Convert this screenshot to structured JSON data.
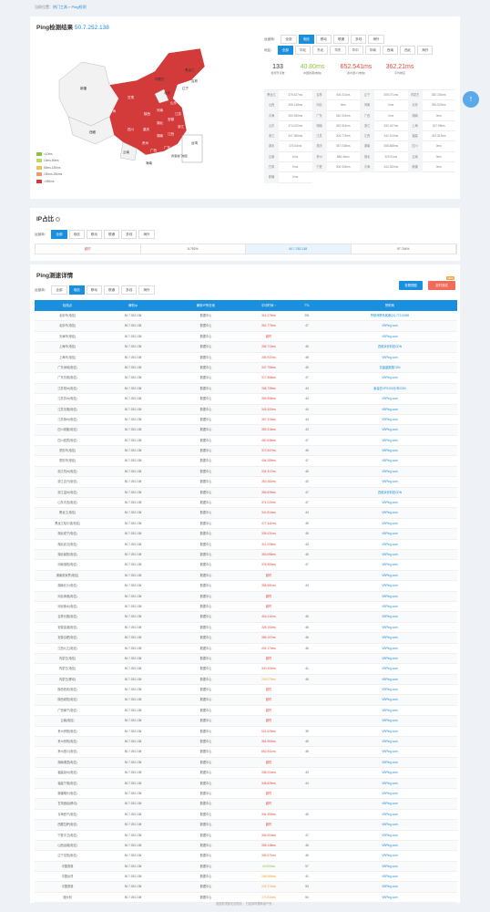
{
  "breadcrumb": {
    "prefix": "当前位置：",
    "link1": "热门工具",
    "sep": " » ",
    "link2": "Ping检测"
  },
  "result": {
    "title": "Ping检测结果",
    "ip": "50.7.252.138"
  },
  "operator": {
    "label": "运营商：",
    "options": [
      "全部",
      "电信",
      "移动",
      "联通",
      "多线",
      "海外"
    ],
    "active": 1
  },
  "region": {
    "label": "地区：",
    "options": [
      "全部",
      "华北",
      "东北",
      "华东",
      "华中",
      "华南",
      "西南",
      "西北",
      "海外"
    ],
    "active": 0
  },
  "stats": [
    {
      "v": "133",
      "l": "检测节点数",
      "c": "#333"
    },
    {
      "v": "40.80ms",
      "l": "中国香港(电信)",
      "c": "#8ac43f"
    },
    {
      "v": "652.541ms",
      "l": "贵州遵义(电信)",
      "c": "#e04a3b"
    },
    {
      "v": "362.21ms",
      "l": "平均响应",
      "c": "#e04a3b"
    }
  ],
  "regions": [
    [
      "黑龙江",
      "375.627ms"
    ],
    [
      "吉林",
      "404.411ms"
    ],
    [
      "辽宁",
      "305.071ms"
    ],
    [
      "内蒙古",
      "382.181ms"
    ],
    [
      "山西",
      "308.148ms"
    ],
    [
      "河北",
      "0ms"
    ],
    [
      "河南",
      "0ms"
    ],
    [
      "北京",
      "364.529ms"
    ],
    [
      "青海",
      "350.355ms"
    ],
    [
      "广东",
      "362.924ms"
    ],
    [
      "广西",
      "0ms"
    ],
    [
      "湖南",
      "0ms"
    ],
    [
      "山东",
      "374.022ms"
    ],
    [
      "湖南",
      "452.516ms"
    ],
    [
      "浙江",
      "330.167ms"
    ],
    [
      "上海",
      "327.95ms"
    ],
    [
      "浙江",
      "347.985ms"
    ],
    [
      "江苏",
      "404.774ms"
    ],
    [
      "江西",
      "340.104ms"
    ],
    [
      "福建",
      "343.513ms"
    ],
    [
      "湖北",
      "376.54ms"
    ],
    [
      "重庆",
      "367.038ms"
    ],
    [
      "湖南",
      "358.888ms"
    ],
    [
      "四川",
      "0ms"
    ],
    [
      "云南",
      "0ms"
    ],
    [
      "贵州",
      "586.44ms"
    ],
    [
      "湖北",
      "329.51ms"
    ],
    [
      "云南",
      "0ms"
    ],
    [
      "甘肃",
      "0ms"
    ],
    [
      "宁夏",
      "306.904ms"
    ],
    [
      "青海",
      "344.353ms"
    ],
    [
      "新疆",
      "0ms"
    ],
    [
      "新疆",
      "0ms"
    ]
  ],
  "legend": [
    "<10ms",
    "10ms-50ms",
    "50ms-150ms",
    "150ms-250ms",
    ">250ms"
  ],
  "legend_colors": [
    "#8ac43f",
    "#b8d96b",
    "#f0c05a",
    "#f09a6a",
    "#d33a3a"
  ],
  "map_labels": [
    "黑龙江",
    "吉林",
    "辽宁",
    "内蒙古",
    "北京",
    "新疆",
    "西藏",
    "青海",
    "甘肃",
    "四川",
    "重庆",
    "贵州",
    "云南",
    "广西",
    "广东",
    "湖南",
    "湖北",
    "江西",
    "浙江",
    "江苏",
    "安徽",
    "山东",
    "河南",
    "陕西",
    "台湾",
    "海南",
    "香港澳门地区"
  ],
  "ip_section": {
    "title": "IP占比",
    "filter_label": "运营商：",
    "filters": [
      "全部",
      "电信",
      "移动",
      "联通",
      "多线",
      "海外"
    ],
    "active": 0,
    "row": [
      "超时",
      "5.752%",
      "50.7.252.138",
      "97.744%"
    ]
  },
  "ping_section": {
    "title": "Ping测速详情",
    "filter_label": "运营商：",
    "filters": [
      "全部",
      "电信",
      "移动",
      "联通",
      "多线",
      "海外"
    ],
    "active": 1,
    "btn_tl": "查看视图",
    "btn_ds": "定时测试",
    "new": "NEW"
  },
  "table_head": [
    "检测点",
    "解析ip",
    "解析IP所在地",
    "平均时间 ↑",
    "TTL",
    "赞助商"
  ],
  "rows": [
    [
      "北京市(电信)",
      "50.7.252.138",
      "数据中心",
      "315.275ms",
      "251",
      "赞助商联系客服QQ:77219399"
    ],
    [
      "北京市(电信)",
      "50.7.252.138",
      "数据中心",
      "361.773ms",
      "47",
      "VBPing.com"
    ],
    [
      "天津市(电信)",
      "50.7.252.138",
      "数据中心",
      "超时",
      "",
      "VBPing.com"
    ],
    [
      "上海市(电信)",
      "50.7.252.138",
      "数据中心",
      "336.713ms",
      "46",
      "四维永安科技CDN"
    ],
    [
      "上海市(电信)",
      "50.7.252.138",
      "数据中心",
      "336.937ms",
      "48",
      "VBPing.com"
    ],
    [
      "广东深圳(电信)",
      "50.7.252.138",
      "数据中心",
      "347.755ms",
      "45",
      "亮晶晶数据CDN"
    ],
    [
      "广东东莞(电信)",
      "50.7.252.138",
      "数据中心",
      "377.558ms",
      "47",
      "VBPing.com"
    ],
    [
      "江苏常州(电信)",
      "50.7.252.138",
      "数据中心",
      "338.735ms",
      "44",
      "秦皇岛VPS100元/年CDN"
    ],
    [
      "江苏苏州(电信)",
      "50.7.252.138",
      "数据中心",
      "355.558ms",
      "44",
      "VBPing.com"
    ],
    [
      "江苏无锡(电信)",
      "50.7.252.138",
      "数据中心",
      "343.332ms",
      "44",
      "VBPing.com"
    ],
    [
      "江苏扬州(电信)",
      "50.7.252.138",
      "数据中心",
      "367.315ms",
      "44",
      "VBPing.com"
    ],
    [
      "四川成都(电信)",
      "50.7.252.138",
      "数据中心",
      "359.216ms",
      "43",
      "VBPing.com"
    ],
    [
      "四川宜宾(电信)",
      "50.7.252.138",
      "数据中心",
      "450.536ms",
      "47",
      "VBPing.com"
    ],
    [
      "重庆市(电信)",
      "50.7.252.138",
      "数据中心",
      "372.547ms",
      "46",
      "VBPing.com"
    ],
    [
      "重庆市(电信)",
      "50.7.252.138",
      "数据中心",
      "404.289ms",
      "47",
      "VBPing.com"
    ],
    [
      "浙江杭州(电信)",
      "50.7.252.138",
      "数据中心",
      "334.317ms",
      "46",
      "VBPing.com"
    ],
    [
      "浙江嘉兴(电信)",
      "50.7.252.138",
      "数据中心",
      "352.482ms",
      "43",
      "VBPing.com"
    ],
    [
      "浙江温州(电信)",
      "50.7.252.138",
      "数据中心",
      "355.839ms",
      "47",
      "四维永安科技CDN"
    ],
    [
      "山东青岛(电信)",
      "50.7.252.138",
      "数据中心",
      "374.022ms",
      "47",
      "VBPing.com"
    ],
    [
      "黑龙江(电信)",
      "50.7.252.138",
      "数据中心",
      "341.814ms",
      "44",
      "VBPing.com"
    ],
    [
      "黑龙江哈尔滨(电信)",
      "50.7.252.138",
      "数据中心",
      "477.441ms",
      "45",
      "VBPing.com"
    ],
    [
      "湖北咸宁(电信)",
      "50.7.252.138",
      "数据中心",
      "335.021ms",
      "45",
      "VBPing.com"
    ],
    [
      "湖北武汉(电信)",
      "50.7.252.138",
      "数据中心",
      "311.209ms",
      "43",
      "VBPing.com"
    ],
    [
      "湖北襄阳(电信)",
      "50.7.252.138",
      "数据中心",
      "353.698ms",
      "45",
      "VBPing.com"
    ],
    [
      "河南洛阳(电信)",
      "50.7.252.138",
      "数据中心",
      "378.553ms",
      "47",
      "VBPing.com"
    ],
    [
      "湖南张家界(电信)",
      "50.7.252.138",
      "数据中心",
      "超时",
      "",
      "VBPing.com"
    ],
    [
      "湖南长沙(电信)",
      "50.7.252.138",
      "数据中心",
      "358.581ms",
      "44",
      "VBPing.com"
    ],
    [
      "河北承德(电信)",
      "50.7.252.138",
      "数据中心",
      "超时",
      "",
      "VBPing.com"
    ],
    [
      "河北衡水(电信)",
      "50.7.252.138",
      "数据中心",
      "超时",
      "",
      "VBPing.com"
    ],
    [
      "吉林长春(电信)",
      "50.7.252.138",
      "数据中心",
      "404.411ms",
      "46",
      "VBPing.com"
    ],
    [
      "安徽芜湖(电信)",
      "50.7.252.138",
      "数据中心",
      "328.153ms",
      "46",
      "VBPing.com"
    ],
    [
      "安徽合肥(电信)",
      "50.7.252.138",
      "数据中心",
      "358.107ms",
      "46",
      "VBPing.com"
    ],
    [
      "江西九江(电信)",
      "50.7.252.138",
      "数据中心",
      "404.174ms",
      "46",
      "VBPing.com"
    ],
    [
      "内蒙古(电信)",
      "50.7.252.138",
      "数据中心",
      "超时",
      "",
      "VBPing.com"
    ],
    [
      "内蒙古(电信)",
      "50.7.252.138",
      "数据中心",
      "340.403ms",
      "41",
      "VBPing.com"
    ],
    [
      "内蒙古(移动)",
      "50.7.252.138",
      "数据中心",
      "225.270ms",
      "46",
      "VBPing.com"
    ],
    [
      "陕西西安(电信)",
      "50.7.252.138",
      "数据中心",
      "超时",
      "",
      "VBPing.com"
    ],
    [
      "陕西咸阳(电信)",
      "50.7.252.138",
      "数据中心",
      "超时",
      "",
      "VBPing.com"
    ],
    [
      "广西南宁(电信)",
      "50.7.252.138",
      "数据中心",
      "超时",
      "",
      "VBPing.com"
    ],
    [
      "云南(电信)",
      "50.7.252.138",
      "数据中心",
      "超时",
      "",
      "VBPing.com"
    ],
    [
      "贵州贵阳(电信)",
      "50.7.252.138",
      "数据中心",
      "521.625ms",
      "39",
      "VBPing.com"
    ],
    [
      "贵州贵阳(电信)",
      "50.7.252.138",
      "数据中心",
      "354.960ms",
      "45",
      "VBPing.com"
    ],
    [
      "贵州遵义(电信)",
      "50.7.252.138",
      "数据中心",
      "652.541ms",
      "46",
      "VBPing.com"
    ],
    [
      "湖南湘潭(电信)",
      "50.7.252.138",
      "数据中心",
      "超时",
      "",
      "VBPing.com"
    ],
    [
      "福建泉州(电信)",
      "50.7.252.138",
      "数据中心",
      "338.204ms",
      "43",
      "VBPing.com"
    ],
    [
      "福建宁德(电信)",
      "50.7.252.138",
      "数据中心",
      "348.825ms",
      "44",
      "VBPing.com"
    ],
    [
      "新疆喀什(电信)",
      "50.7.252.138",
      "数据中心",
      "超时",
      "",
      "VBPing.com"
    ],
    [
      "甘肃酒泉(移动)",
      "50.7.252.138",
      "数据中心",
      "超时",
      "",
      "VBPing.com"
    ],
    [
      "青海西宁(电信)",
      "50.7.252.138",
      "数据中心",
      "344.353ms",
      "45",
      "VBPing.com"
    ],
    [
      "西藏拉萨(电信)",
      "50.7.252.138",
      "数据中心",
      "超时",
      "",
      "VBPing.com"
    ],
    [
      "宁夏中卫(电信)",
      "50.7.252.138",
      "数据中心",
      "306.904ms",
      "47",
      "VBPing.com"
    ],
    [
      "山西运城(电信)",
      "50.7.252.138",
      "数据中心",
      "308.148ms",
      "46",
      "VBPing.com"
    ],
    [
      "辽宁沈阳(电信)",
      "50.7.252.138",
      "数据中心",
      "305.071ms",
      "46",
      "VBPing.com"
    ],
    [
      "中国香港",
      "50.7.252.138",
      "数据中心",
      "40.800ms",
      "57",
      "VBPing.com"
    ],
    [
      "中国台湾",
      "50.7.252.138",
      "数据中心",
      "248.560ms",
      "41",
      "VBPing.com"
    ],
    [
      "中国香港",
      "50.7.252.138",
      "数据中心",
      "228.710ms",
      "53",
      "VBPing.com"
    ],
    [
      "澳大利",
      "50.7.252.138",
      "数据中心",
      "173.834ms",
      "54",
      "VBPing.com"
    ]
  ],
  "footer": "返回到顶部无法检测 ，已经暂时跳转用户页..."
}
